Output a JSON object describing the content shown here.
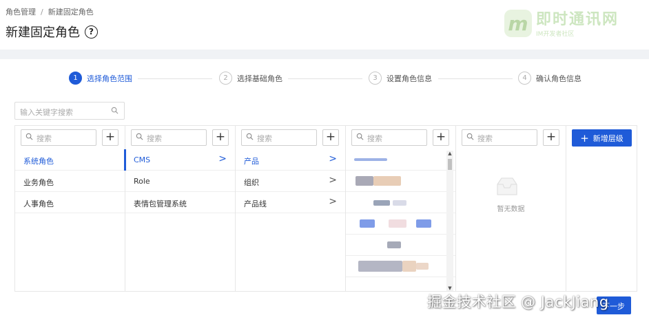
{
  "breadcrumb": {
    "parent": "角色管理",
    "current": "新建固定角色"
  },
  "page_title": "新建固定角色",
  "watermark_logo": {
    "badge": "m",
    "title": "即时通讯网",
    "subtitle": "IM开发者社区"
  },
  "steps": [
    {
      "num": "1",
      "label": "选择角色范围",
      "active": true
    },
    {
      "num": "2",
      "label": "选择基础角色",
      "active": false
    },
    {
      "num": "3",
      "label": "设置角色信息",
      "active": false
    },
    {
      "num": "4",
      "label": "确认角色信息",
      "active": false
    }
  ],
  "keyword_search": {
    "placeholder": "输入关键字搜索"
  },
  "column_search_placeholder": "搜索",
  "add_icon": "+",
  "columns": [
    {
      "items": [
        {
          "label": "系统角色",
          "selected": true
        },
        {
          "label": "业务角色"
        },
        {
          "label": "人事角色"
        }
      ]
    },
    {
      "items": [
        {
          "label": "CMS",
          "selected": true,
          "chevron": ">"
        },
        {
          "label": "Role"
        },
        {
          "label": "表情包管理系统"
        }
      ]
    },
    {
      "items": [
        {
          "label": "产品",
          "selected": true,
          "chevron": ">"
        },
        {
          "label": "组织",
          "chevron": ">"
        },
        {
          "label": "产品线",
          "chevron": ">"
        }
      ]
    }
  ],
  "empty_text": "暂无数据",
  "add_level_button": "新增层级",
  "bottom_button": "下一步",
  "watermark_text": "掘金技术社区 @ JackJiang",
  "colors": {
    "primary": "#1f5bd8",
    "border": "#e6e6e6"
  },
  "icons": {
    "search": "search-icon",
    "help": "question-circle-icon",
    "chevron": "chevron-right-icon",
    "empty": "empty-box-icon"
  }
}
